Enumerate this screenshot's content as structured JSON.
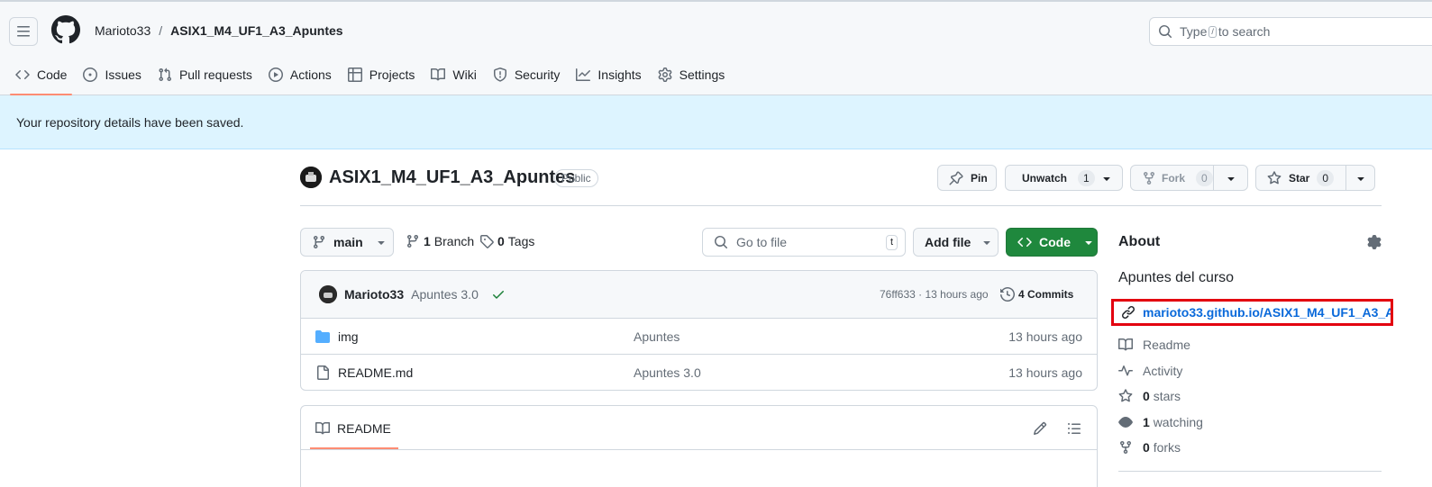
{
  "header": {
    "owner": "Marioto33",
    "separator": "/",
    "repo": "ASIX1_M4_UF1_A3_Apuntes",
    "search_prefix": "Type",
    "search_key": "/",
    "search_suffix": "to search"
  },
  "tabs": [
    {
      "label": "Code",
      "icon": "code-icon"
    },
    {
      "label": "Issues",
      "icon": "issue-icon"
    },
    {
      "label": "Pull requests",
      "icon": "pull-request-icon"
    },
    {
      "label": "Actions",
      "icon": "play-icon"
    },
    {
      "label": "Projects",
      "icon": "table-icon"
    },
    {
      "label": "Wiki",
      "icon": "book-icon"
    },
    {
      "label": "Security",
      "icon": "shield-icon"
    },
    {
      "label": "Insights",
      "icon": "graph-icon"
    },
    {
      "label": "Settings",
      "icon": "gear-icon"
    }
  ],
  "flash": {
    "message": "Your repository details have been saved."
  },
  "repo": {
    "title": "ASIX1_M4_UF1_A3_Apuntes",
    "visibility": "Public",
    "pin_label": "Pin",
    "unwatch_label": "Unwatch",
    "watch_count": "1",
    "fork_label": "Fork",
    "fork_count": "0",
    "star_label": "Star",
    "star_count": "0"
  },
  "toolbar": {
    "branch": "main",
    "branches_count": "1",
    "branches_label": "Branch",
    "tags_count": "0",
    "tags_label": "Tags",
    "goto_placeholder": "Go to file",
    "goto_key": "t",
    "add_file_label": "Add file",
    "code_label": "Code"
  },
  "commit": {
    "author": "Marioto33",
    "message": "Apuntes 3.0",
    "sha_time": "76ff633 · 13 hours ago",
    "commits_label": "4 Commits"
  },
  "files": [
    {
      "name": "img",
      "type": "folder",
      "message": "Apuntes",
      "date": "13 hours ago"
    },
    {
      "name": "README.md",
      "type": "file",
      "message": "Apuntes 3.0",
      "date": "13 hours ago"
    }
  ],
  "readme": {
    "tab_label": "README"
  },
  "about": {
    "heading": "About",
    "description": "Apuntes del curso",
    "link": "marioto33.github.io/ASIX1_M4_UF1_A3_A...",
    "readme": "Readme",
    "activity": "Activity",
    "stars_count": "0",
    "stars_label": "stars",
    "watching_count": "1",
    "watching_label": "watching",
    "forks_count": "0",
    "forks_label": "forks"
  },
  "colors": {
    "accent": "#1f883d",
    "link": "#0969da",
    "flash_bg": "#ddf4ff",
    "tab_underline": "#fd8c73",
    "highlight_box": "#e3000f"
  }
}
